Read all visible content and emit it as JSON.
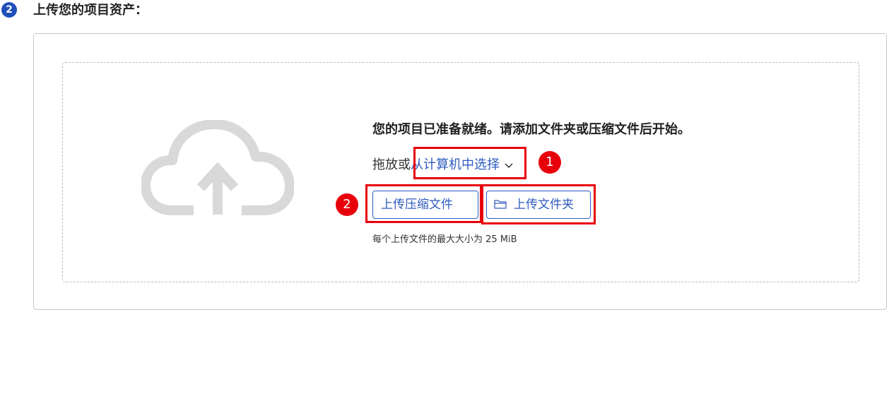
{
  "step": {
    "number": "2",
    "title": "上传您的项目资产："
  },
  "dropzone": {
    "ready_text": "您的项目已准备就绪。请添加文件夹或压缩文件后开始。",
    "drop_prefix": "拖放或",
    "choose_link": "从计算机中选择",
    "upload_zip_label": "上传压缩文件",
    "upload_folder_label": "上传文件夹",
    "size_note": "每个上传文件的最大大小为 25 MiB",
    "icons": {
      "cloud": "cloud-upload-icon",
      "chevron": "chevron-down-icon",
      "folder": "folder-icon"
    }
  },
  "annotations": {
    "badge_1": "1",
    "badge_2": "2"
  },
  "colors": {
    "accent": "#2f5bbf",
    "step_badge": "#1f4fb8",
    "annotation_red": "#e8000b",
    "cloud_gray": "#d9d9d9"
  }
}
